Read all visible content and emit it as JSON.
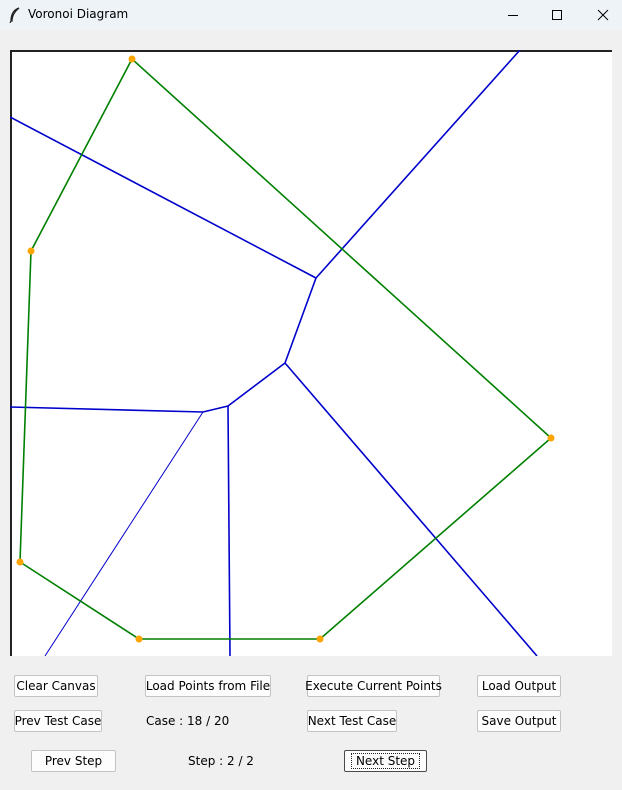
{
  "window": {
    "title": "Voronoi Diagram",
    "icon": "feather-icon",
    "controls": [
      "minimize-icon",
      "maximize-icon",
      "close-icon"
    ]
  },
  "canvas": {
    "background": "#ffffff",
    "site_color": "#ffa500",
    "hull_color": "#008000",
    "voronoi_color": "#0000cc"
  },
  "buttons": {
    "clear_canvas": "Clear Canvas",
    "load_points": "Load Points from File",
    "execute_points": "Execute Current Points",
    "load_output": "Load Output",
    "prev_test_case": "Prev Test Case",
    "next_test_case": "Next Test Case",
    "save_output": "Save Output",
    "prev_step": "Prev Step",
    "next_step": "Next Step"
  },
  "status": {
    "case": "Case : 18 / 20",
    "step": "Step : 2 / 2"
  }
}
